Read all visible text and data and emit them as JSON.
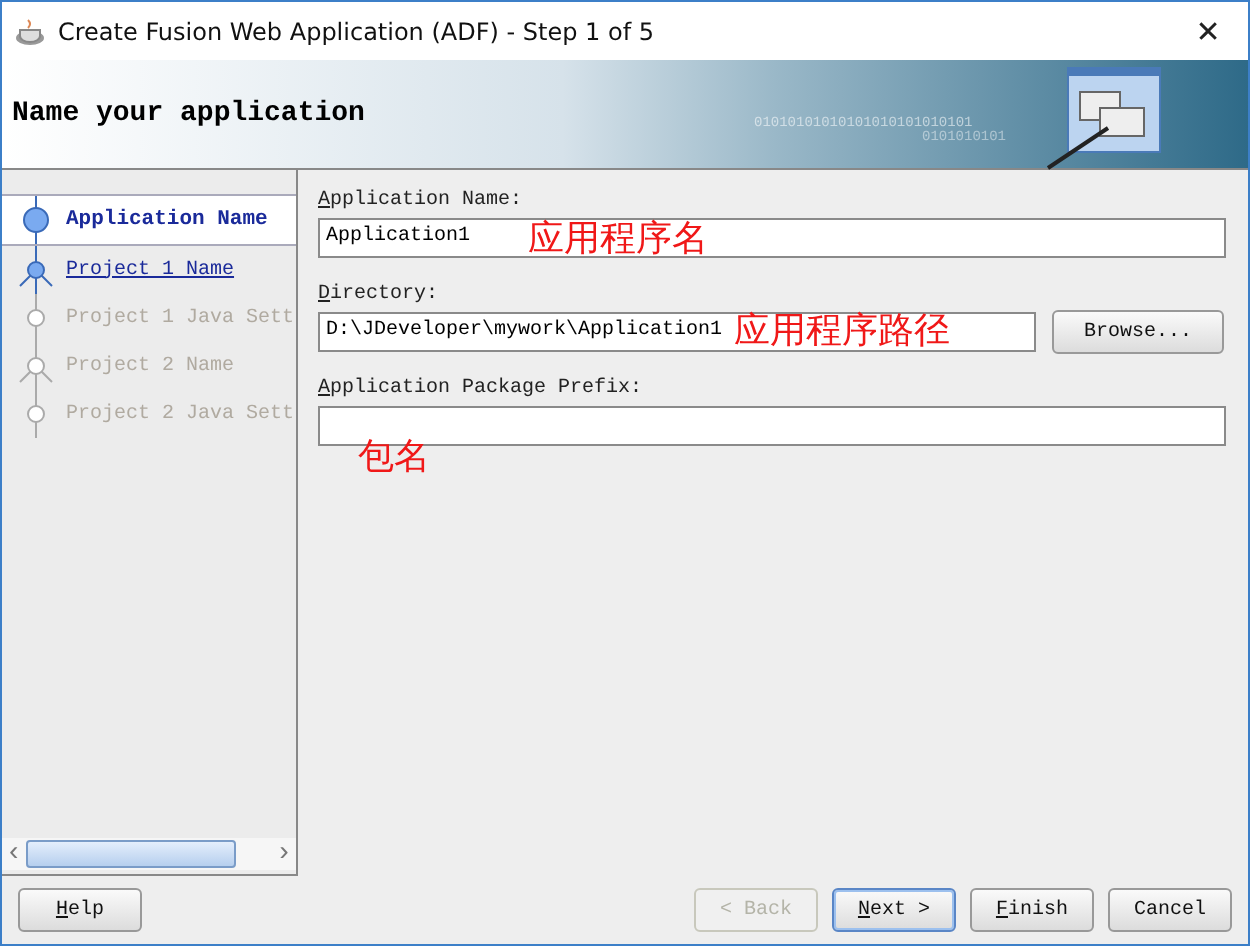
{
  "window": {
    "title": "Create Fusion Web Application (ADF) - Step 1 of 5",
    "close": "✕"
  },
  "header": {
    "title": "Name your application",
    "binary": "01010101010101010101010101",
    "binary2": "0101010101"
  },
  "steps": [
    {
      "label": "Application Name",
      "kind": "circle",
      "selected": true,
      "disabled": false
    },
    {
      "label": "Project 1 Name",
      "kind": "branch",
      "selected": false,
      "disabled": false
    },
    {
      "label": "Project 1 Java Sett",
      "kind": "circle",
      "selected": false,
      "disabled": true
    },
    {
      "label": "Project 2 Name",
      "kind": "branch",
      "selected": false,
      "disabled": true
    },
    {
      "label": "Project 2 Java Sett",
      "kind": "circle",
      "selected": false,
      "disabled": true
    }
  ],
  "form": {
    "name_label": "Application Name:",
    "name_value": "Application1",
    "name_note": "应用程序名",
    "dir_label": "Directory:",
    "dir_value": "D:\\JDeveloper\\mywork\\Application1",
    "dir_note": "应用程序路径",
    "browse": "Browse...",
    "prefix_label": "Application Package Prefix:",
    "prefix_note": "包名"
  },
  "scroll": {
    "left": "‹",
    "right": "›"
  },
  "buttons": {
    "help": "Help",
    "back": "< Back",
    "next": "Next >",
    "finish": "Finish",
    "cancel": "Cancel"
  }
}
